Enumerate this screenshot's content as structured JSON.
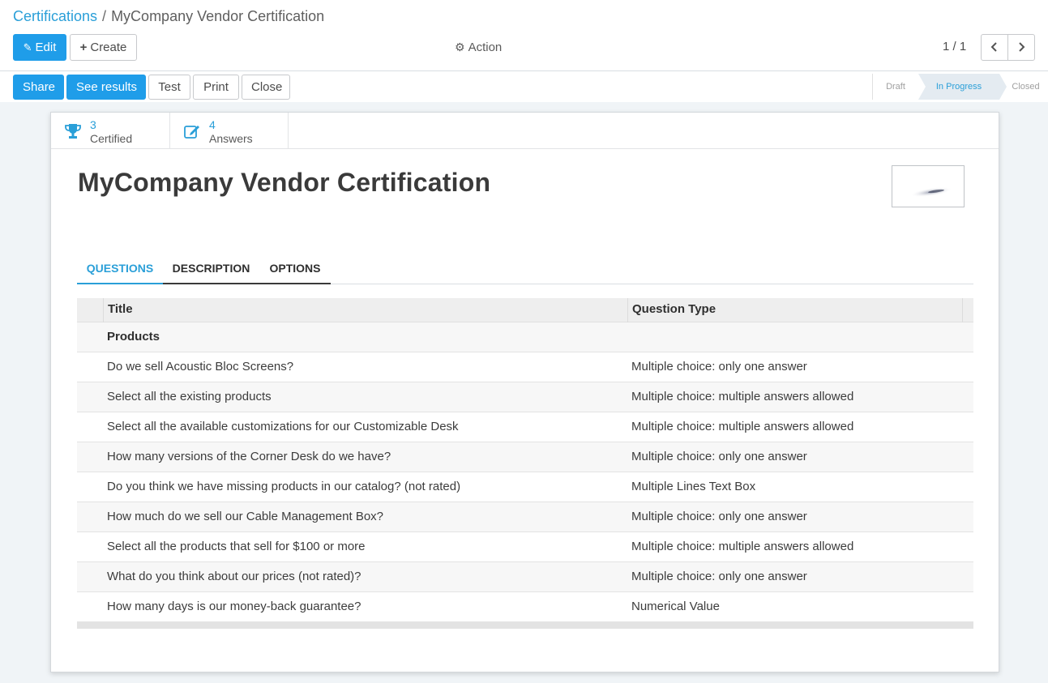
{
  "breadcrumb": {
    "parent": "Certifications",
    "separator": "/",
    "current": "MyCompany Vendor Certification"
  },
  "toolbar": {
    "edit_label": "Edit",
    "create_label": "Create",
    "action_label": "Action"
  },
  "pager": {
    "value": "1 / 1"
  },
  "statusbar": {
    "buttons": {
      "share": "Share",
      "see_results": "See results",
      "test": "Test",
      "print": "Print",
      "close": "Close"
    },
    "stages": [
      "Draft",
      "In Progress",
      "Closed"
    ],
    "active_stage": "In Progress"
  },
  "stats": {
    "certified": {
      "count": "3",
      "label": "Certified"
    },
    "answers": {
      "count": "4",
      "label": "Answers"
    }
  },
  "form": {
    "title": "MyCompany Vendor Certification",
    "tabs": [
      "QUESTIONS",
      "DESCRIPTION",
      "OPTIONS"
    ],
    "active_tab": "QUESTIONS"
  },
  "table": {
    "columns": [
      "Title",
      "Question Type"
    ],
    "rows": [
      {
        "title": "Products",
        "type": ""
      },
      {
        "title": "Do we sell Acoustic Bloc Screens?",
        "type": "Multiple choice: only one answer"
      },
      {
        "title": "Select all the existing products",
        "type": "Multiple choice: multiple answers allowed"
      },
      {
        "title": "Select all the available customizations for our Customizable Desk",
        "type": "Multiple choice: multiple answers allowed"
      },
      {
        "title": "How many versions of the Corner Desk do we have?",
        "type": "Multiple choice: only one answer"
      },
      {
        "title": "Do you think we have missing products in our catalog? (not rated)",
        "type": "Multiple Lines Text Box"
      },
      {
        "title": "How much do we sell our Cable Management Box?",
        "type": "Multiple choice: only one answer"
      },
      {
        "title": "Select all the products that sell for $100 or more",
        "type": "Multiple choice: multiple answers allowed"
      },
      {
        "title": "What do you think about our prices (not rated)?",
        "type": "Multiple choice: only one answer"
      },
      {
        "title": "How many days is our money-back guarantee?",
        "type": "Numerical Value"
      }
    ]
  },
  "colors": {
    "primary": "#1f9de9",
    "link": "#2a9fd8",
    "active_stage_bg": "#e4ebf1"
  }
}
